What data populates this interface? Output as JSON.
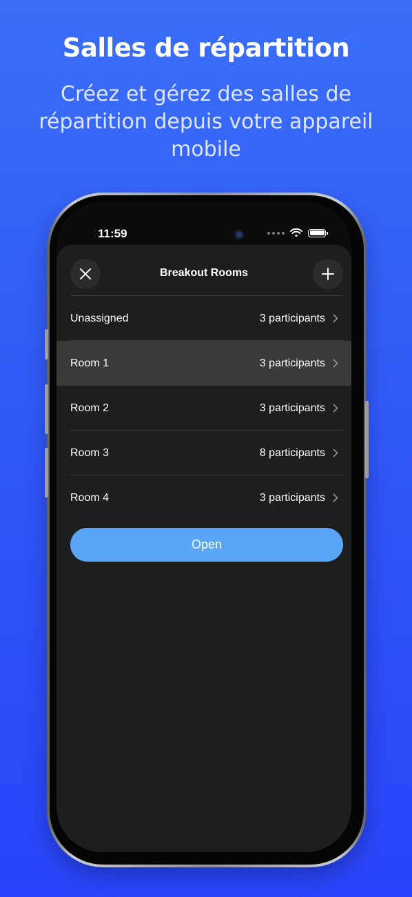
{
  "promo": {
    "title": "Salles de répartition",
    "subtitle": "Créez et gérez des salles de répartition depuis votre appareil mobile"
  },
  "status_bar": {
    "time": "11:59",
    "icons": [
      "camera-dot-icon",
      "signal-dots-icon",
      "wifi-icon",
      "battery-icon"
    ]
  },
  "sheet": {
    "title": "Breakout Rooms",
    "close_icon": "close-icon",
    "add_icon": "plus-icon",
    "rooms": [
      {
        "name": "Unassigned",
        "count": "3 participants",
        "selected": false
      },
      {
        "name": "Room 1",
        "count": "3 participants",
        "selected": true
      },
      {
        "name": "Room 2",
        "count": "3 participants",
        "selected": false
      },
      {
        "name": "Room 3",
        "count": "8 participants",
        "selected": false
      },
      {
        "name": "Room 4",
        "count": "3 participants",
        "selected": false
      }
    ],
    "open_label": "Open"
  },
  "colors": {
    "background_top": "#3a6ef6",
    "background_bottom": "#2a45fb",
    "sheet": "#1e1e20",
    "selected_row": "#3a3a3c",
    "open_button": "#5aa5f6"
  }
}
